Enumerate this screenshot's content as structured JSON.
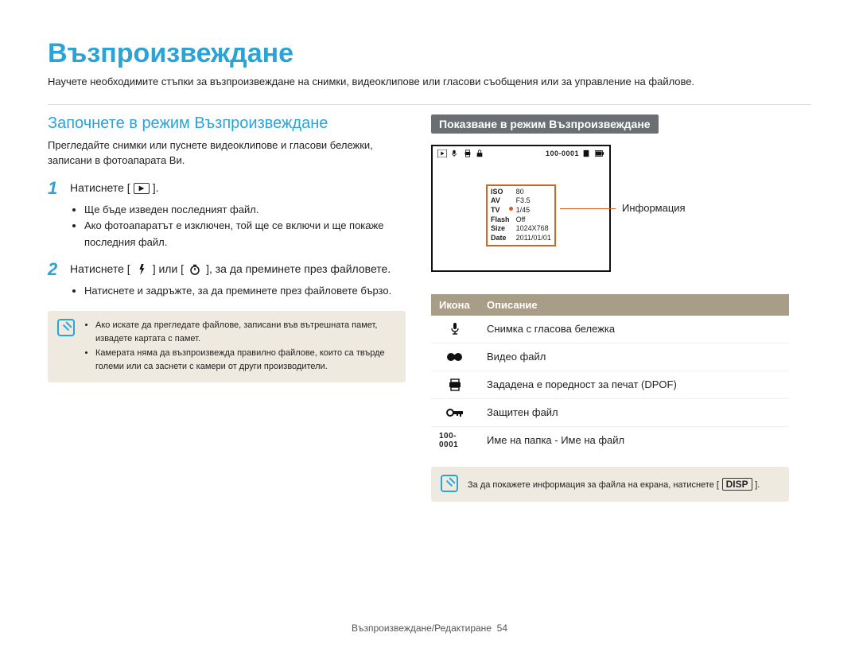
{
  "page_title": "Възпроизвеждане",
  "intro": "Научете необходимите стъпки за възпроизвеждане на снимки, видеоклипове или гласови съобщения или за управление на файлове.",
  "left": {
    "heading": "Започнете в режим Възпроизвеждане",
    "subtext": "Прегледайте снимки или пуснете видеоклипове и гласови бележки, записани в фотоапарата Ви.",
    "steps": [
      {
        "num": "1",
        "text_pre": "Натиснете [",
        "icon": "playback-mode-icon",
        "text_post": "].",
        "bullets": [
          "Ще бъде изведен последният файл.",
          "Ако фотоапаратът е изключен, той ще се включи и ще покаже последния файл."
        ]
      },
      {
        "num": "2",
        "text_pre": "Натиснете [",
        "icon": "flash-icon",
        "text_mid": "] или [",
        "icon2": "timer-icon",
        "text_post": "], за да преминете през файловете.",
        "bullets": [
          "Натиснете и задръжте, за да преминете през файловете бързо."
        ]
      }
    ],
    "note_items": [
      "Ако искате да прегледате файлове, записани във вътрешната памет, извадете картата с памет.",
      "Камерата няма да възпроизвежда правилно файлове, които са твърде големи или са заснети с камери от други производители."
    ]
  },
  "right": {
    "heading": "Показване в режим Възпроизвеждане",
    "preview": {
      "file_counter": "100-0001",
      "info_rows": [
        {
          "k": "ISO",
          "v": "80"
        },
        {
          "k": "AV",
          "v": "F3.5"
        },
        {
          "k": "TV",
          "v": "1/45"
        },
        {
          "k": "Flash",
          "v": "Off"
        },
        {
          "k": "Size",
          "v": "1024X768"
        },
        {
          "k": "Date",
          "v": "2011/01/01"
        }
      ],
      "info_label": "Информация"
    },
    "table": {
      "headers": [
        "Икона",
        "Описание"
      ],
      "rows": [
        {
          "icon": "mic-icon",
          "desc": "Снимка с гласова бележка"
        },
        {
          "icon": "video-icon",
          "desc": "Видео файл"
        },
        {
          "icon": "printer-icon",
          "desc": "Зададена е поредност за печат (DPOF)"
        },
        {
          "icon": "lock-icon",
          "desc": "Защитен файл"
        },
        {
          "icon": "folder-file-text",
          "desc": "Име на папка - Име на файл",
          "icon_text": "100-0001"
        }
      ]
    },
    "note": {
      "pre": "За да покажете информация за файла на екрана, натиснете [",
      "btn": "DISP",
      "post": "]."
    }
  },
  "footer": {
    "section": "Възпроизвеждане/Редактиране",
    "page": "54"
  }
}
